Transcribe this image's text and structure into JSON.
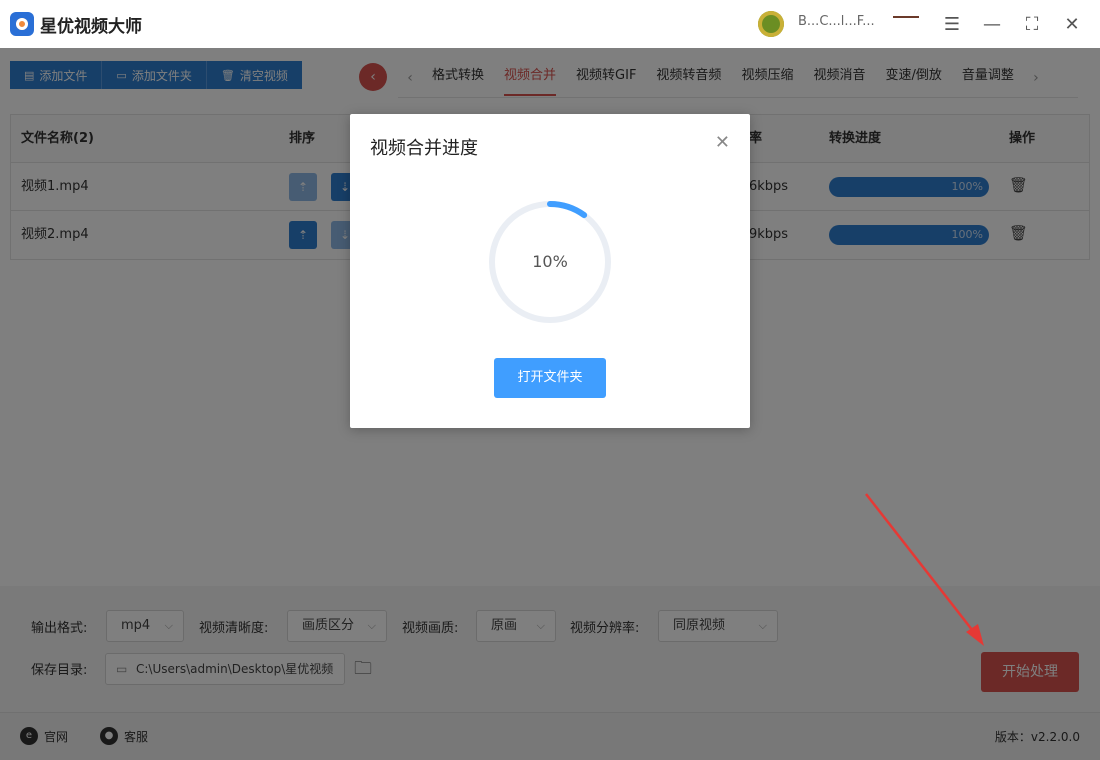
{
  "app": {
    "title": "星优视频大师",
    "user_name": "B...C...l...F..."
  },
  "toolbar": {
    "add_file": "添加文件",
    "add_folder": "添加文件夹",
    "clear_videos": "清空视频"
  },
  "tabs": [
    "格式转换",
    "视频合并",
    "视频转GIF",
    "视频转音频",
    "视频压缩",
    "视频消音",
    "变速/倒放",
    "音量调整"
  ],
  "active_tab": "视频合并",
  "table": {
    "headers": {
      "name": "文件名称(2)",
      "sort": "排序",
      "bitrate": "率",
      "progress": "转换进度",
      "action": "操作"
    },
    "rows": [
      {
        "name": "视频1.mp4",
        "bitrate": "6kbps",
        "progress_text": "100%",
        "progress": 100
      },
      {
        "name": "视频2.mp4",
        "bitrate": "9kbps",
        "progress_text": "100%",
        "progress": 100
      }
    ]
  },
  "settings": {
    "output_format_label": "输出格式:",
    "output_format": "mp4",
    "clarity_label": "视频清晰度:",
    "clarity": "画质区分",
    "quality_label": "视频画质:",
    "quality": "原画",
    "resolution_label": "视频分辨率:",
    "resolution": "同原视频",
    "save_dir_label": "保存目录:",
    "save_dir": "C:\\Users\\admin\\Desktop\\星优视频",
    "start_button": "开始处理"
  },
  "footer": {
    "website": "官网",
    "support": "客服",
    "version": "版本：v2.2.0.0"
  },
  "dialog": {
    "title": "视频合并进度",
    "progress_text": "10%",
    "progress": 10,
    "open_folder": "打开文件夹"
  },
  "colors": {
    "primary": "#2f7fd1",
    "accent_red": "#d9534f",
    "dialog_button": "#409eff"
  }
}
